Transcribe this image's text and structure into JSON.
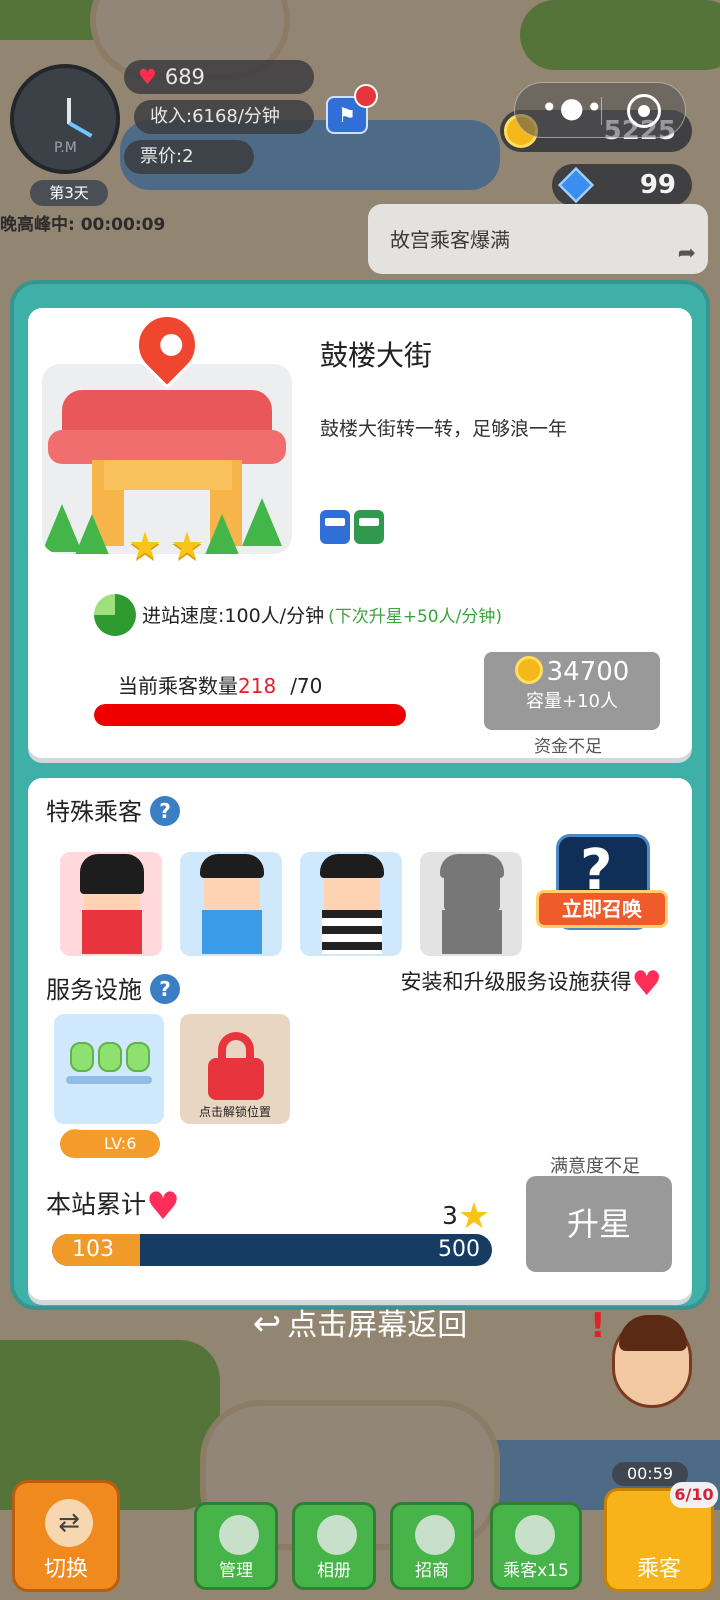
{
  "hud": {
    "clock_period": "P.M",
    "day": "第3天",
    "peak_status": "晚高峰中: 00:00:09",
    "hearts": "689",
    "income": "收入:6168/分钟",
    "fare": "票价:2",
    "coins": "5225",
    "gems": "99",
    "news": "故宫乘客爆满"
  },
  "station": {
    "name": "鼓楼大街",
    "description": "鼓楼大街转一转，足够浪一年",
    "stars": 2,
    "line_tags": [
      "#2f6fd6",
      "#2f9a4e"
    ],
    "speed": "进站速度:100人/分钟",
    "speed_next": "(下次升星+50人/分钟)",
    "passenger_label": "当前乘客数量",
    "passenger_current": "218",
    "passenger_max": "/70",
    "passenger_fill": 1.0,
    "capacity_cost": "34700",
    "capacity_sub": "容量+10人",
    "capacity_status": "资金不足"
  },
  "special": {
    "title": "特殊乘客",
    "help": "?",
    "summon_label": "立即召唤"
  },
  "facilities": {
    "title": "服务设施",
    "help": "?",
    "hint": "安装和升级服务设施获得",
    "level": "LV:6",
    "unlock_label": "点击解锁位置"
  },
  "totals": {
    "title": "本站累计",
    "star_count": "3",
    "current": "103",
    "max": "500",
    "fill": 0.2,
    "satisfaction_note": "满意度不足",
    "upgrade_label": "升星"
  },
  "back_label": "点击屏幕返回",
  "toolbar": {
    "switch": "切换",
    "manage": "管理",
    "album": "相册",
    "invest": "招商",
    "passengers_x": "乘客x15",
    "passengers": "乘客",
    "timer": "00:59",
    "count": "6/10"
  },
  "colors": {
    "modal": "#3fb0a8",
    "accent_red": "#ee0000",
    "speed_green": "#3aa53a",
    "disabled_gray": "#999999"
  }
}
